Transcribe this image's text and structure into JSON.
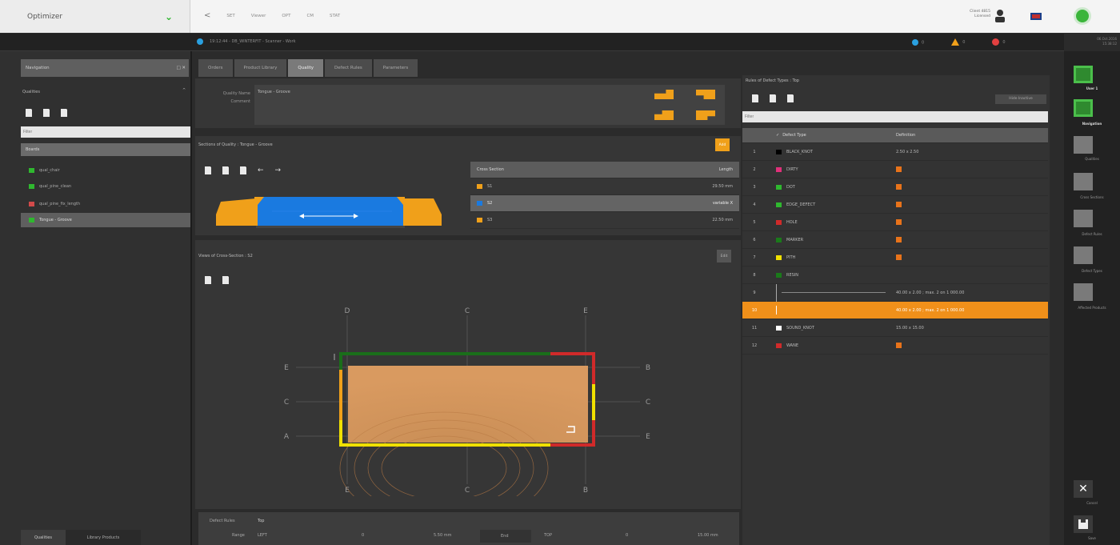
{
  "topbar": {
    "app_title": "Optimizer",
    "nav_items": [
      "SET",
      "Viewer",
      "OPT",
      "CM",
      "STAT"
    ],
    "license_lines": [
      "Client 4815",
      "Licensed"
    ]
  },
  "statusbar": {
    "session_text": "19:12:44 - DB_WINTERFIT - Scanner - Work",
    "info_count": "0",
    "warn_count": "0",
    "error_count": "0",
    "date": "06.Oct.2016",
    "time": "15:38:12"
  },
  "navigation": {
    "header": "Navigation",
    "window_controls": "□ ✕",
    "section_label": "Qualities",
    "collapse_glyph": "^",
    "filter_placeholder": "Filter",
    "group_label": "Boards",
    "items": [
      {
        "label": "qual_chair",
        "color": "#2fb82f"
      },
      {
        "label": "qual_pine_clean",
        "color": "#2fb82f"
      },
      {
        "label": "qual_pine_fix_length",
        "color": "#d24a4a"
      },
      {
        "label": "Tongue - Groove",
        "color": "#2fb82f"
      }
    ],
    "bottom_tabs": [
      "Qualities",
      "Library Products"
    ]
  },
  "tabs": [
    "Orders",
    "Product Library",
    "Quality",
    "Defect Rules",
    "Parameters"
  ],
  "quality": {
    "name_label": "Quality Name",
    "comment_label": "Comment",
    "name_value": "Tongue - Groove"
  },
  "sections": {
    "header": "Sections of Quality : Tongue - Groove",
    "add_label": "Add",
    "col_section": "Cross Section",
    "col_length": "Length",
    "rows": [
      {
        "name": "S1",
        "length": "29.50 mm",
        "color": "#f0a01a"
      },
      {
        "name": "S2",
        "length": "variable X",
        "color": "#1a7ae0"
      },
      {
        "name": "S3",
        "length": "22.50 mm",
        "color": "#f0a01a"
      }
    ]
  },
  "views": {
    "header": "Views of Cross-Section : S2",
    "edit_label": "Edit",
    "labels": [
      "D",
      "C",
      "E",
      "E",
      "B",
      "C",
      "C",
      "A",
      "E",
      "E",
      "C",
      "B"
    ]
  },
  "defect_rules_bottom": {
    "label": "Defect Rules",
    "value": "Top",
    "range_label": "Range",
    "range_side": "LEFT",
    "range_zero": "0",
    "range_val": "5.50 mm",
    "end_label": "End",
    "end_side": "TOP",
    "end_zero": "0",
    "end_val": "15.00 mm"
  },
  "rules": {
    "header": "Rules of Defect Types : Top",
    "hide_label": "Hide Inactive",
    "filter_placeholder": "Filter",
    "col_type": "Defect Type",
    "col_def": "Definition",
    "rows": [
      {
        "n": "1",
        "type": "BLACK_KNOT",
        "def": "2.50 x 2.50",
        "color": "#000000",
        "orange": false
      },
      {
        "n": "2",
        "type": "DIRTY",
        "def": "",
        "color": "#e0307a",
        "orange": true
      },
      {
        "n": "3",
        "type": "DOT",
        "def": "",
        "color": "#2fb82f",
        "orange": true
      },
      {
        "n": "4",
        "type": "EDGE_DEFECT",
        "def": "",
        "color": "#2fb82f",
        "orange": true
      },
      {
        "n": "5",
        "type": "HOLE",
        "def": "",
        "color": "#d02a2a",
        "orange": true
      },
      {
        "n": "6",
        "type": "MARKER",
        "def": "",
        "color": "#1a7a1a",
        "orange": true
      },
      {
        "n": "7",
        "type": "PITH",
        "def": "",
        "color": "#f0e000",
        "orange": true
      },
      {
        "n": "8",
        "type": "RESIN",
        "def": "",
        "color": "#1a7a1a",
        "orange": false
      },
      {
        "n": "9",
        "type": "",
        "def": "40.00 x 2.00 ; max. 2 on 1 000.00",
        "color": "",
        "orange": false
      },
      {
        "n": "10",
        "type": "",
        "def": "40.00 x 2.00 ; max. 2 on 1 000.00",
        "color": "",
        "orange": false
      },
      {
        "n": "11",
        "type": "SOUND_KNOT",
        "def": "15.00 x 15.00",
        "color": "#ffffff",
        "orange": false
      },
      {
        "n": "12",
        "type": "WANE",
        "def": "",
        "color": "#d02a2a",
        "orange": true
      }
    ]
  },
  "sidebar": {
    "items": [
      "User 1",
      "Navigation",
      "Qualities",
      "Cross Sections",
      "Defect Rules",
      "Defect Types",
      "Affected Products"
    ],
    "cancel_label": "Cancel",
    "save_label": "Save"
  }
}
